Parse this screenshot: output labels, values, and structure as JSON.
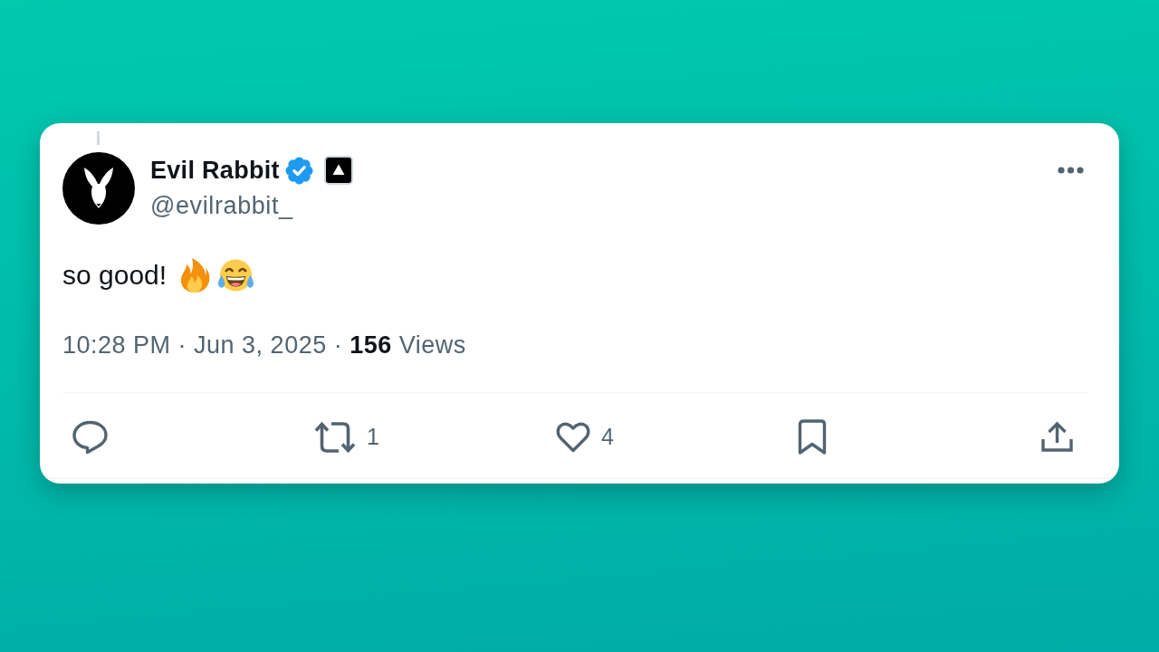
{
  "tweet": {
    "author": {
      "name": "Evil Rabbit",
      "verified": true,
      "affiliation": true,
      "handle": "@evilrabbit_"
    },
    "text": "so good!",
    "emoji": [
      {
        "kind": "fire"
      },
      {
        "kind": "tears_of_joy"
      }
    ],
    "meta": "10:28 PM · Jun 3, 2025 · **156** Views",
    "actions": [
      {
        "kind": "reply"
      },
      {
        "kind": "repost",
        "count": "1"
      },
      {
        "kind": "like",
        "count": "4"
      },
      {
        "kind": "bookmark"
      },
      {
        "kind": "share"
      }
    ]
  }
}
